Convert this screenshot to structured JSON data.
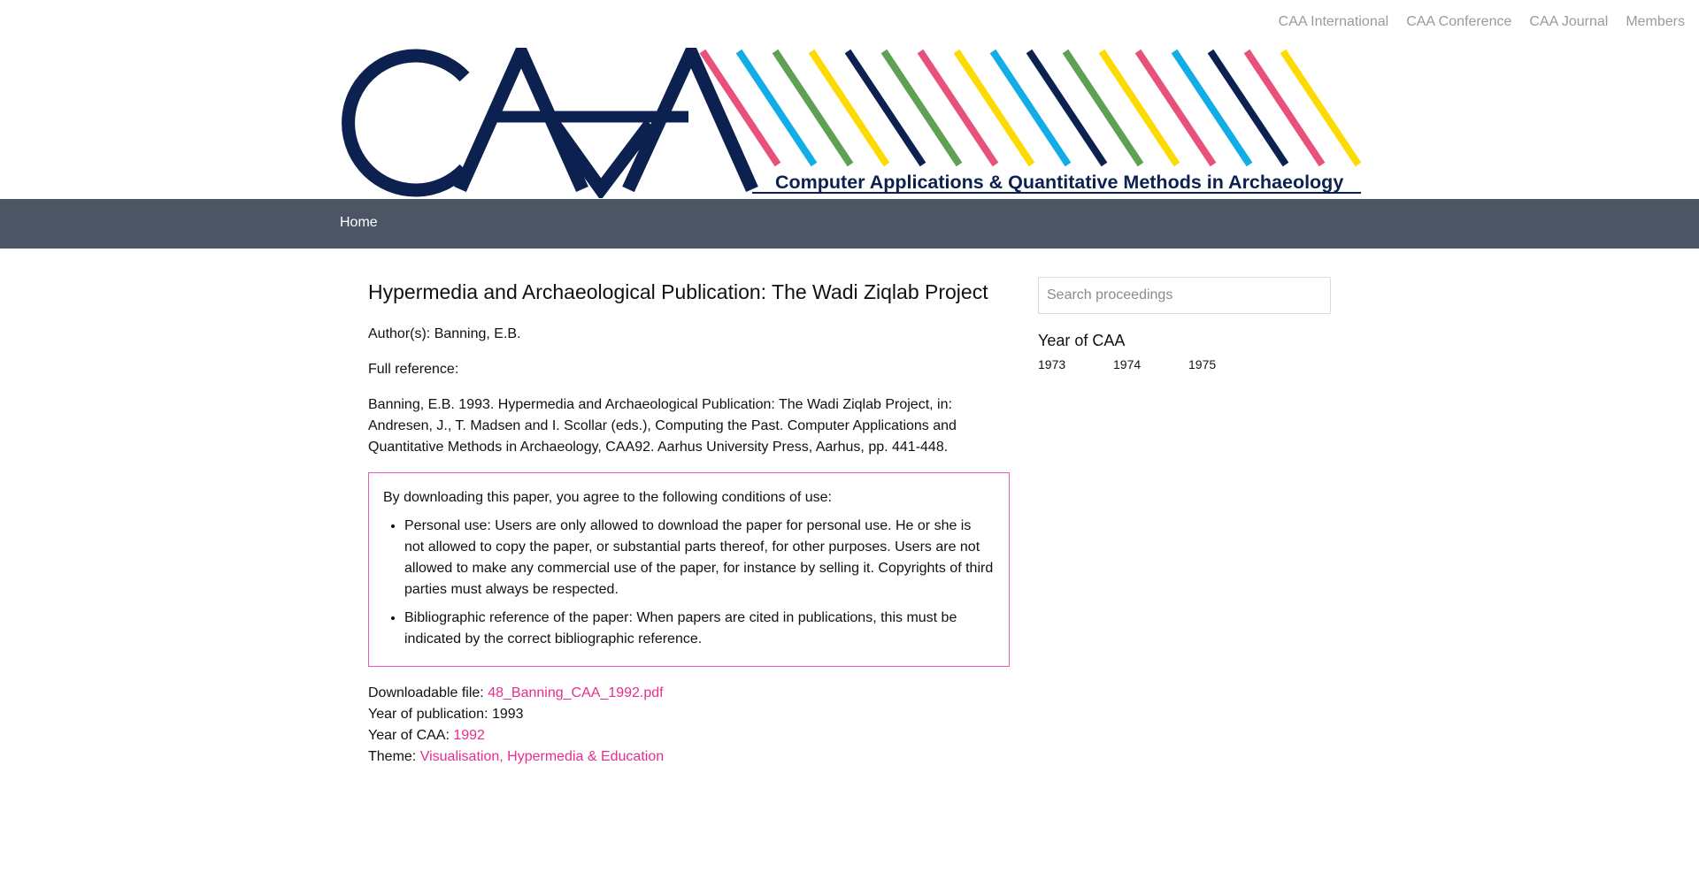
{
  "topnav": {
    "items": [
      "CAA International",
      "CAA Conference",
      "CAA Journal",
      "Members"
    ]
  },
  "banner": {
    "logo_text": "CAA",
    "subtitle": "Computer Applications & Quantitative Methods in Archaeology",
    "brand_color": "#0d2150",
    "stripe_colors": [
      "#e8527a",
      "#12ade6",
      "#5ea153",
      "#fedb00",
      "#0d2150"
    ]
  },
  "navbar": {
    "home": "Home",
    "background": "#4b5564"
  },
  "article": {
    "title": "Hypermedia and Archaeological Publication: The Wadi Ziqlab Project",
    "authors": "Author(s): Banning, E.B.",
    "full_reference_label": "Full reference:",
    "full_reference": "Banning, E.B. 1993. Hypermedia and Archaeological Publication: The Wadi Ziqlab Project, in: Andresen, J., T. Madsen and I. Scollar (eds.), Computing the Past. Computer Applications and Quantitative Methods in Archaeology, CAA92. Aarhus University Press, Aarhus, pp. 441-448.",
    "conditions_intro": "By downloading this paper, you agree to the following conditions of use:",
    "conditions": [
      "Personal use: Users are only allowed to download the paper for personal use. He or she is not allowed to copy the paper, or substantial parts thereof, for other purposes. Users are not allowed to make any commercial use of the paper, for instance by selling it. Copyrights of third parties must always be respected.",
      "Bibliographic reference of the paper: When papers are cited in publications, this must be indicated by the correct bibliographic reference."
    ],
    "download_label": "Downloadable file:",
    "download_file": "48_Banning_CAA_1992.pdf",
    "year_pub_label": "Year of publication:",
    "year_pub": "1993",
    "year_caa_label": "Year of CAA:",
    "year_caa": "1992",
    "theme_label": "Theme:",
    "theme": "Visualisation, Hypermedia & Education",
    "link_color": "#e62e8c"
  },
  "sidebar": {
    "search_placeholder": "Search proceedings",
    "year_heading": "Year of CAA",
    "years": [
      "1973",
      "1974",
      "1975"
    ]
  }
}
